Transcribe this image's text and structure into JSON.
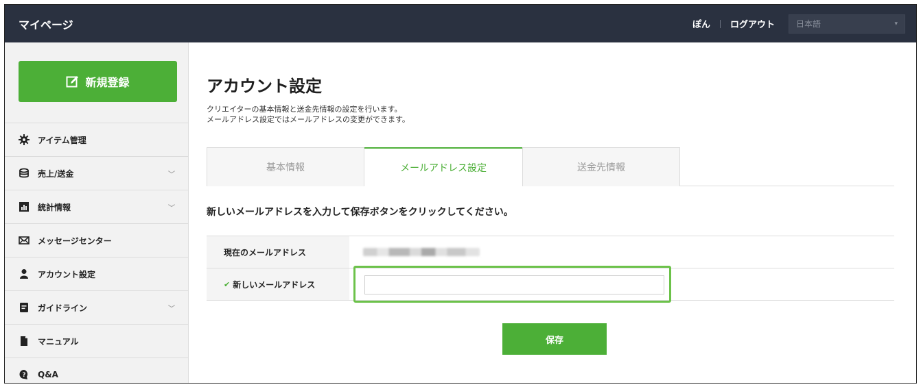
{
  "header": {
    "title": "マイページ",
    "user_name": "ぽん",
    "logout": "ログアウト",
    "language": {
      "selected": "日本語"
    }
  },
  "sidebar": {
    "new_button": "新規登録",
    "items": [
      {
        "label": "アイテム管理",
        "icon": "gear-icon",
        "expandable": false
      },
      {
        "label": "売上/送金",
        "icon": "database-icon",
        "expandable": true
      },
      {
        "label": "統計情報",
        "icon": "chart-icon",
        "expandable": true
      },
      {
        "label": "メッセージセンター",
        "icon": "mail-icon",
        "expandable": false
      },
      {
        "label": "アカウント設定",
        "icon": "user-icon",
        "expandable": false
      },
      {
        "label": "ガイドライン",
        "icon": "document-icon",
        "expandable": true
      },
      {
        "label": "マニュアル",
        "icon": "file-icon",
        "expandable": false
      },
      {
        "label": "Q&A",
        "icon": "question-icon",
        "expandable": false
      }
    ]
  },
  "main": {
    "title": "アカウント設定",
    "description": [
      "クリエイターの基本情報と送金先情報の設定を行います。",
      "メールアドレス設定ではメールアドレスの変更ができます。"
    ],
    "tabs": [
      {
        "label": "基本情報",
        "active": false
      },
      {
        "label": "メールアドレス設定",
        "active": true
      },
      {
        "label": "送金先情報",
        "active": false
      }
    ],
    "instruction": "新しいメールアドレスを入力して保存ボタンをクリックしてください。",
    "form": {
      "current_email_label": "現在のメールアドレス",
      "new_email_label": "新しいメールアドレス",
      "new_email_value": ""
    },
    "save_button": "保存"
  },
  "colors": {
    "header_bg": "#2a3140",
    "accent_green": "#4caf37",
    "highlight_green": "#6cc24a"
  }
}
